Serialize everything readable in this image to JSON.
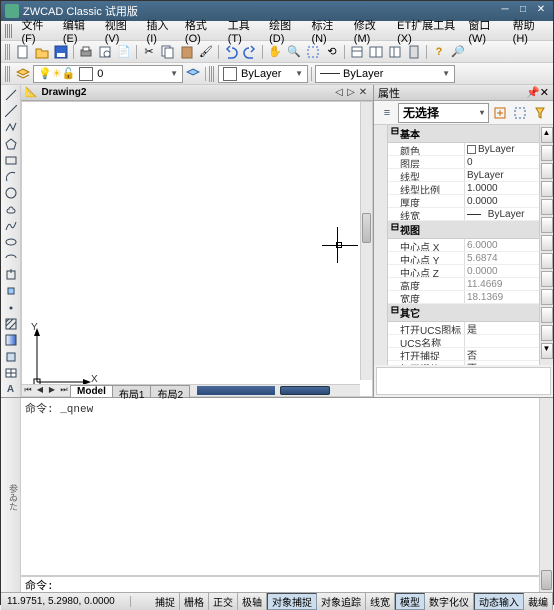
{
  "title": "ZWCAD Classic 试用版",
  "menu": [
    "文件(F)",
    "编辑(E)",
    "视图(V)",
    "插入(I)",
    "格式(O)",
    "工具(T)",
    "绘图(D)",
    "标注(N)",
    "修改(M)",
    "ET扩展工具(X)",
    "窗口(W)",
    "帮助(H)"
  ],
  "layer_combo": "0",
  "linetype_prop": "ByLayer",
  "linetype_combo": "ByLayer",
  "drawing_tab": "Drawing2",
  "props_title": "属性",
  "props_selector": "无选择",
  "groups": {
    "basic": "基本",
    "view": "视图",
    "other": "其它"
  },
  "rows": {
    "color": {
      "k": "颜色",
      "v": "ByLayer"
    },
    "layer": {
      "k": "图层",
      "v": "0"
    },
    "ltype": {
      "k": "线型",
      "v": "ByLayer"
    },
    "ltscale": {
      "k": "线型比例",
      "v": "1.0000"
    },
    "thick": {
      "k": "厚度",
      "v": "0.0000"
    },
    "lweight": {
      "k": "线宽",
      "v": "ByLayer"
    },
    "cx": {
      "k": "中心点 X",
      "v": "6.0000"
    },
    "cy": {
      "k": "中心点 Y",
      "v": "5.6874"
    },
    "cz": {
      "k": "中心点 Z",
      "v": "0.0000"
    },
    "h": {
      "k": "高度",
      "v": "11.4669"
    },
    "w": {
      "k": "宽度",
      "v": "18.1369"
    },
    "ucs": {
      "k": "打开UCS图标",
      "v": "是"
    },
    "ucsname": {
      "k": "UCS名称",
      "v": ""
    },
    "snap": {
      "k": "打开捕捉",
      "v": "否"
    },
    "grid": {
      "k": "打开栅格",
      "v": "否"
    }
  },
  "sheets": {
    "model": "Model",
    "l1": "布局1",
    "l2": "布局2"
  },
  "cmd_hist": "命令: _qnew",
  "cmd_prompt": "命令:",
  "cmd_side": "参ゐた",
  "coords": "11.9751, 5.2980, 0.0000",
  "status": [
    "捕捉",
    "栅格",
    "正交",
    "极轴",
    "对象捕捉",
    "对象追踪",
    "线宽",
    "模型",
    "数字化仪",
    "动态输入",
    "裁编"
  ],
  "axis": {
    "x": "X",
    "y": "Y"
  }
}
